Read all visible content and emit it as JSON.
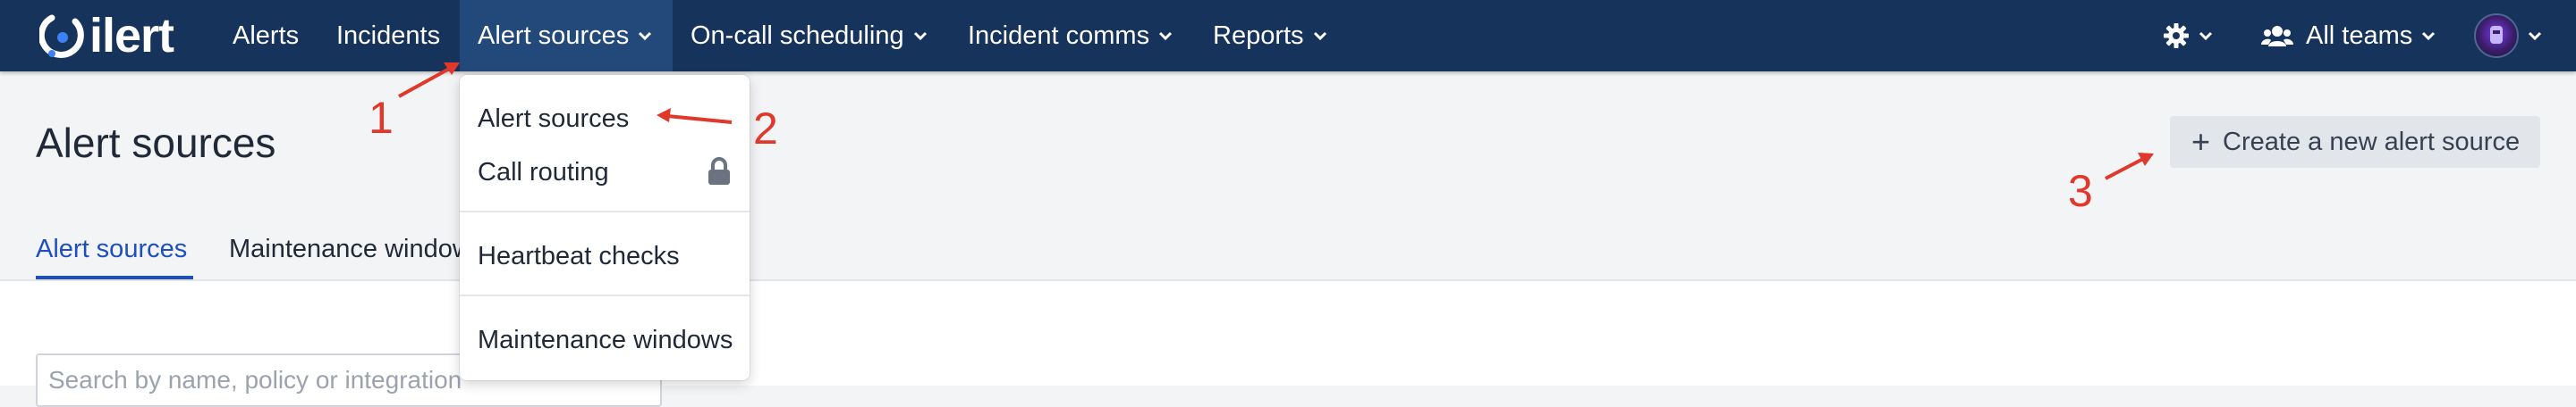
{
  "nav": {
    "logo_text": "ilert",
    "items": [
      {
        "label": "Alerts"
      },
      {
        "label": "Incidents"
      },
      {
        "label": "Alert sources"
      },
      {
        "label": "On-call scheduling"
      },
      {
        "label": "Incident comms"
      },
      {
        "label": "Reports"
      }
    ],
    "teams_label": "All teams",
    "icons": {
      "settings": "gear-icon",
      "teams": "users-icon",
      "avatar": "avatar",
      "logo": "ilert-logo-icon",
      "chevron": "chevron-down-icon"
    }
  },
  "page": {
    "title": "Alert sources",
    "create_button_label": "Create a new alert source"
  },
  "tabs": [
    {
      "label": "Alert sources",
      "active": true
    },
    {
      "label": "Maintenance windows",
      "active": false
    }
  ],
  "search": {
    "placeholder": "Search by name, policy or integration"
  },
  "dropdown": {
    "items": [
      {
        "label": "Alert sources"
      },
      {
        "label": "Call routing",
        "locked": true
      },
      {
        "label": "Heartbeat checks"
      },
      {
        "label": "Maintenance windows"
      }
    ]
  },
  "annotations": [
    "1",
    "2",
    "3"
  ],
  "colors": {
    "nav_bg": "#16335c",
    "nav_active_bg": "#23497a",
    "accent": "#1e4fc2",
    "annotation": "#e0382b",
    "page_bg": "#f3f4f6"
  }
}
